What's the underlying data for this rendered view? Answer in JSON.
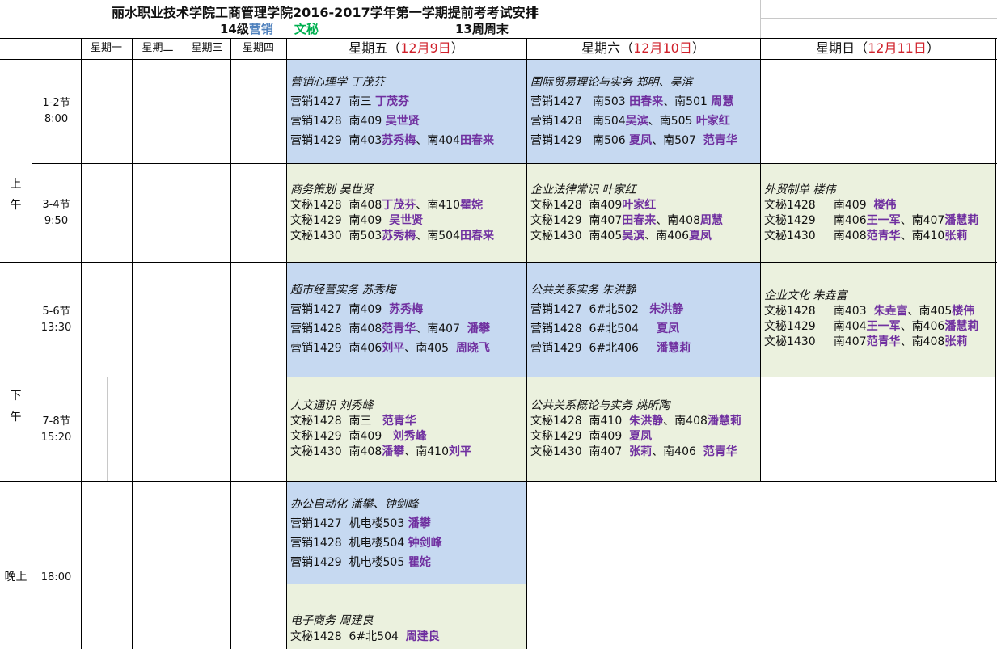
{
  "title": "丽水职业技术学院工商管理学院2016-2017学年第一学期提前考考试安排",
  "subtitle": {
    "grade": "14级",
    "major1": "营销",
    "major2": "文秘",
    "week": "13周周末"
  },
  "colors": {
    "blue_fill": "#c6d9f1",
    "green_fill": "#ebf1de",
    "teacher": "#7030a0",
    "date": "#d0202a",
    "major1": "#4f81bd",
    "major2": "#00b050"
  },
  "days": {
    "mon": "星期一",
    "tue": "星期二",
    "wed": "星期三",
    "thu": "星期四",
    "fri": {
      "label": "星期五（",
      "date": "12月9日",
      "end": "）"
    },
    "sat": {
      "label": "星期六（",
      "date": "12月10日",
      "end": "）"
    },
    "sun": {
      "label": "星期日（",
      "date": "12月11日",
      "end": "）"
    }
  },
  "periods": {
    "am": {
      "a": "上",
      "b": "午"
    },
    "pm": {
      "a": "下",
      "b": "午"
    },
    "eve": "晚上",
    "p12": {
      "a": "1-2节",
      "b": "8:00"
    },
    "p34": {
      "a": "3-4节",
      "b": "9:50"
    },
    "p56": {
      "a": "5-6节",
      "b": "13:30"
    },
    "p78": {
      "a": "7-8节",
      "b": "15:20"
    },
    "p9": "18:00"
  },
  "exams": {
    "fri12": {
      "subject": "营销心理学 丁茂芬",
      "rows": [
        {
          "cls": "营销1427  南三 ",
          "t": "丁茂芬"
        },
        {
          "cls": "营销1428  南409 ",
          "t": "吴世贤"
        },
        {
          "cls": "营销1429  南403",
          "t": "苏秀梅",
          "mid": "、南404",
          "t2": "田春来"
        }
      ]
    },
    "sat12": {
      "subject": "国际贸易理论与实务  郑明、吴滨",
      "rows": [
        {
          "cls": "营销1427   南503 ",
          "t": "田春来",
          "mid": "、南501 ",
          "t2": "周慧"
        },
        {
          "cls": "营销1428   南504",
          "t": "吴滨",
          "mid": "、南505 ",
          "t2": "叶家红"
        },
        {
          "cls": "营销1429   南506 ",
          "t": "夏凤",
          "mid": "、南507  ",
          "t2": "范青华"
        }
      ]
    },
    "fri34": {
      "subject": "商务策划  吴世贤",
      "rows": [
        {
          "cls": "文秘1428  南408",
          "t": "丁茂芬",
          "mid": "、南410",
          "t2": "瞿姹"
        },
        {
          "cls": "文秘1429  南409  ",
          "t": "吴世贤"
        },
        {
          "cls": "文秘1430  南503",
          "t": "苏秀梅",
          "mid": "、南504",
          "t2": "田春来"
        }
      ]
    },
    "sat34": {
      "subject": "企业法律常识   叶家红",
      "rows": [
        {
          "cls": "文秘1428  南409",
          "t": "叶家红"
        },
        {
          "cls": "文秘1429  南407",
          "t": "田春来",
          "mid": "、南408",
          "t2": "周慧"
        },
        {
          "cls": "文秘1430  南405",
          "t": "吴滨",
          "mid": "、南406",
          "t2": "夏凤"
        }
      ]
    },
    "sun34": {
      "subject": "外贸制单  楼伟",
      "rows": [
        {
          "cls": "文秘1428     南409  ",
          "t": "楼伟"
        },
        {
          "cls": "文秘1429     南406",
          "t": "王一军",
          "mid": "、南407",
          "t2": "潘慧莉"
        },
        {
          "cls": "文秘1430     南408",
          "t": "范青华",
          "mid": "、南410",
          "t2": "张莉"
        }
      ]
    },
    "fri56": {
      "subject": "超市经营实务  苏秀梅",
      "rows": [
        {
          "cls": "营销1427  南409  ",
          "t": "苏秀梅"
        },
        {
          "cls": "营销1428  南408",
          "t": "范青华",
          "mid": "、南407  ",
          "t2": "潘攀"
        },
        {
          "cls": "营销1429  南406",
          "t": "刘平",
          "mid": "、南405  ",
          "t2": "周晓飞"
        }
      ]
    },
    "sat56": {
      "subject": "公共关系实务  朱洪静",
      "rows": [
        {
          "cls": "营销1427  6#北502   ",
          "t": "朱洪静"
        },
        {
          "cls": "营销1428  6#北504     ",
          "t": "夏凤"
        },
        {
          "cls": "营销1429  6#北406     ",
          "t": "潘慧莉"
        }
      ]
    },
    "sun56": {
      "subject": "企业文化  朱垚富",
      "rows": [
        {
          "cls": "文秘1428     南403  ",
          "t": "朱垚富",
          "mid": "、南405",
          "t2": "楼伟"
        },
        {
          "cls": "文秘1429     南404",
          "t": "王一军",
          "mid": "、南406",
          "t2": "潘慧莉"
        },
        {
          "cls": "文秘1430     南407",
          "t": "范青华",
          "mid": "、南408",
          "t2": "张莉"
        }
      ]
    },
    "fri78": {
      "subject": "人文通识  刘秀峰",
      "rows": [
        {
          "cls": "文秘1428  南三   ",
          "t": "范青华"
        },
        {
          "cls": "文秘1429  南409   ",
          "t": "刘秀峰"
        },
        {
          "cls": "文秘1430  南408",
          "t": "潘攀",
          "mid": "、南410",
          "t2": "刘平"
        }
      ]
    },
    "sat78": {
      "subject": "公共关系概论与实务     姚昕陶",
      "rows": [
        {
          "cls": "文秘1428  南410  ",
          "t": "朱洪静",
          "mid": "、南408",
          "t2": "潘慧莉"
        },
        {
          "cls": "文秘1429  南409  ",
          "t": "夏凤"
        },
        {
          "cls": "文秘1430  南407  ",
          "t": "张莉",
          "mid": "、南406  ",
          "t2": "范青华"
        }
      ]
    },
    "fri9a": {
      "subject": "办公自动化 潘攀、钟剑峰",
      "rows": [
        {
          "cls": "营销1427  机电楼503 ",
          "t": "潘攀"
        },
        {
          "cls": "营销1428  机电楼504 ",
          "t": "钟剑峰"
        },
        {
          "cls": "营销1429  机电楼505 ",
          "t": "瞿姹"
        }
      ]
    },
    "fri9b": {
      "subject": "电子商务   周建良",
      "rows": [
        {
          "cls": "文秘1428  6#北504  ",
          "t": "周建良"
        }
      ]
    }
  }
}
